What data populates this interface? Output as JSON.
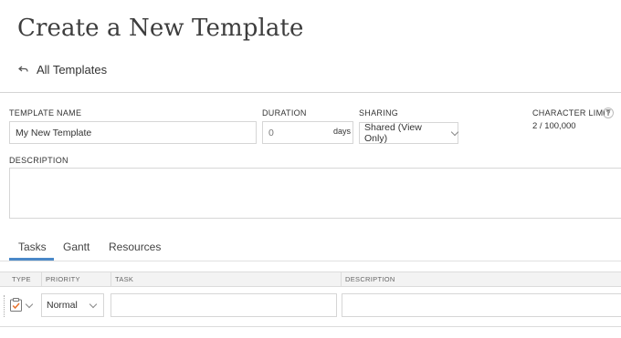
{
  "page": {
    "title": "Create a New Template",
    "back_link": "All Templates"
  },
  "form": {
    "template_name": {
      "label": "TEMPLATE NAME",
      "value": "My New Template"
    },
    "duration": {
      "label": "DURATION",
      "value": "0",
      "unit": "days"
    },
    "sharing": {
      "label": "SHARING",
      "value": "Shared (View Only)"
    },
    "character_limit": {
      "label": "CHARACTER LIMIT",
      "help": "?",
      "value": "2 / 100,000"
    },
    "description": {
      "label": "DESCRIPTION",
      "value": ""
    }
  },
  "tabs": [
    {
      "label": "Tasks",
      "active": true
    },
    {
      "label": "Gantt",
      "active": false
    },
    {
      "label": "Resources",
      "active": false
    }
  ],
  "grid": {
    "columns": [
      "TYPE",
      "PRIORITY",
      "TASK",
      "DESCRIPTION"
    ],
    "rows": [
      {
        "type_icon": "task-check-icon",
        "priority": "Normal",
        "task": "",
        "description": ""
      }
    ]
  },
  "colors": {
    "accent": "#4a88c8",
    "task_icon": "#e8722c",
    "border": "#d6d6d6"
  }
}
